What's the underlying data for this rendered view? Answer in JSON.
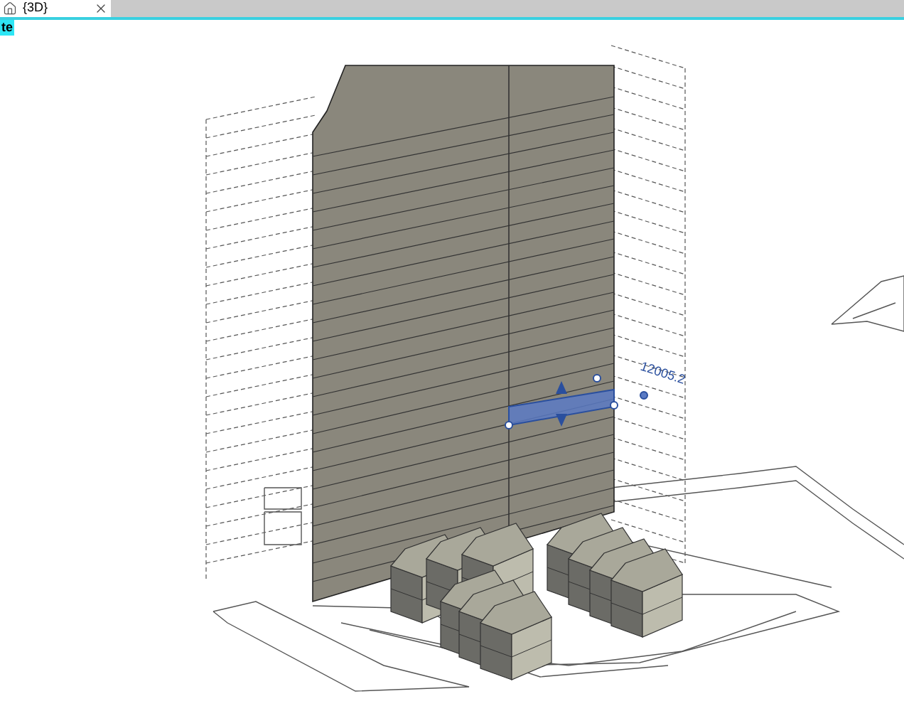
{
  "tabs": [
    {
      "label": "{3D}",
      "selected": true
    }
  ],
  "view_badge": "te",
  "dimension": "12005.2"
}
